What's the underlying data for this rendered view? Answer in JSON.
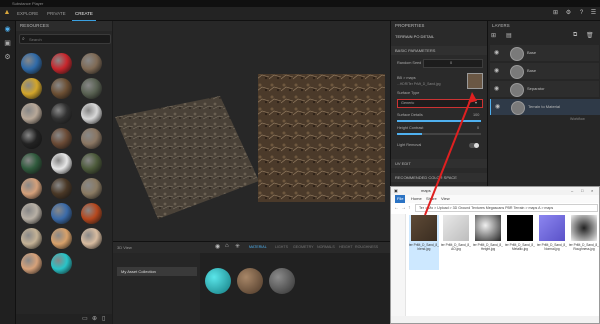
{
  "window": {
    "title": "Substance Player"
  },
  "topbar": {
    "tabs": [
      "EXPLORE",
      "PRIVATE",
      "CREATE"
    ],
    "active_tab": 2
  },
  "resources": {
    "title": "RESOURCES",
    "search_placeholder": "Search"
  },
  "materials": {
    "colors": [
      "#2f6aa8",
      "#c8262c",
      "#7f6a55",
      "#d2a52a",
      "#6c4f33",
      "#596152",
      "#b8a898",
      "#323232",
      "#d8d8d8",
      "#222222",
      "#6a4a35",
      "#8a7662",
      "#2f5a3c",
      "#e6e6e6",
      "#4c5a3a",
      "#d4a07a",
      "#4a3826",
      "#8a7a62",
      "#b8b0a5",
      "#3a6aa8",
      "#b6481e",
      "#c4b296",
      "#d8a16a",
      "#d8bca0",
      "#d7a27a",
      "#28c4c8"
    ]
  },
  "viewport": {
    "label": "3D View",
    "modes": [
      "MATERIAL",
      "LIGHTS",
      "GEOMETRY",
      "NORMALS",
      "HEIGHT",
      "ROUGHNESS METAL"
    ]
  },
  "collection": {
    "item": "My Asset Collection"
  },
  "properties": {
    "title": "PROPERTIES",
    "material_name": "TERRAIN PO DETAIL",
    "section_basic": "BASIC PARAMETERS",
    "random_seed_label": "Random Seed",
    "random_seed_value": "0",
    "map_label": "BB > maps",
    "map_file": "...HDR\\Ter PrMt_D_Sand.jpg",
    "surface_type_label": "Surface Type",
    "surface_type_value": "Generic",
    "surface_details_label": "Surface Details",
    "surface_details_value": "100",
    "height_contrast_label": "Height Contrast",
    "height_contrast_value": "0",
    "light_removal_label": "Light Removal",
    "section_uv": "UV EDIT",
    "section_adv": "RECOMMENDED COLOR SPACE"
  },
  "layers": {
    "title": "LAYERS",
    "items": [
      {
        "name": "Base"
      },
      {
        "name": "Base"
      },
      {
        "name": "Separator"
      },
      {
        "name": "Terrain to Material"
      }
    ],
    "footer": "Workflow"
  },
  "explorer": {
    "title": "maps",
    "menu": [
      "File",
      "Home",
      "Share",
      "View"
    ],
    "path": "Ter > Mo > Upload > 3D Ground Textures Megascans PBR Terrain > maps A > maps",
    "files": [
      "ter PrMt_D_Sand_8_blend.jpg",
      "ter PrMt_D_Sand_8_AO.jpg",
      "ter PrMt_D_Sand_8_Height.jpg",
      "ter PrMt_D_Sand_8_Metallic.jpg",
      "ter PrMt_D_Sand_8_Normal.jpg",
      "ter PrMt_D_Sand_8_Roughness.jpg"
    ]
  }
}
